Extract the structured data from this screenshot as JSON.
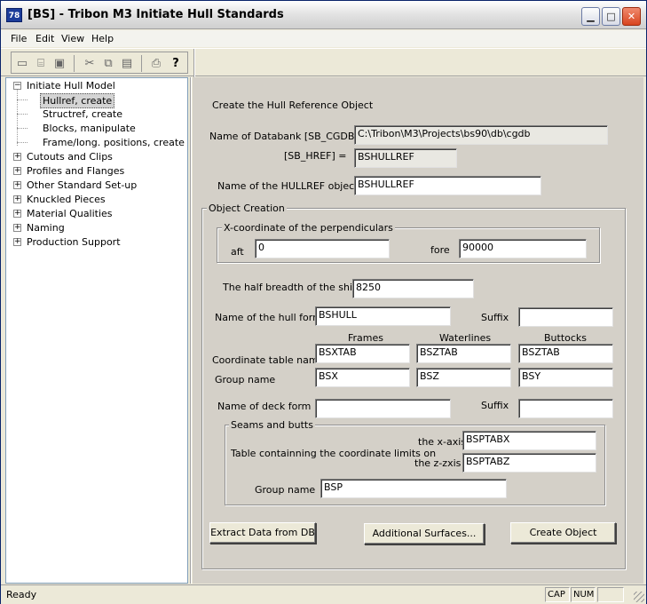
{
  "window": {
    "title": "[BS] - Tribon M3 Initiate Hull Standards",
    "icon_text": "78"
  },
  "menu": [
    "File",
    "Edit",
    "View",
    "Help"
  ],
  "toolbar": {
    "buttons": [
      "new-icon",
      "open-icon",
      "save-icon",
      "cut-icon",
      "copy-icon",
      "paste-icon",
      "print-icon",
      "help-icon"
    ]
  },
  "tree": {
    "root": "Initiate Hull Model",
    "children": [
      "Hullref, create",
      "Structref, create",
      "Blocks, manipulate",
      "Frame/long. positions, create"
    ],
    "selected": "Hullref, create",
    "siblings": [
      "Cutouts and Clips",
      "Profiles and Flanges",
      "Other Standard Set-up",
      "Knuckled Pieces",
      "Material Qualities",
      "Naming",
      "Production Support"
    ]
  },
  "form": {
    "heading": "Create the Hull Reference Object",
    "databank_label": "Name of Databank [SB_CGDB] =",
    "databank_value": "C:\\Tribon\\M3\\Projects\\bs90\\db\\cgdb",
    "href_label": "[SB_HREF] =",
    "href_value": "BSHULLREF",
    "hullref_label": "Name of the HULLREF object",
    "hullref_value": "BSHULLREF",
    "object_creation": "Object Creation",
    "xcoord_group": "X-coordinate of the perpendiculars",
    "aft_label": "aft",
    "aft_value": "0",
    "fore_label": "fore",
    "fore_value": "90000",
    "half_breadth_label": "The half breadth of the ship",
    "half_breadth_value": "8250",
    "hull_form_label": "Name of the hull form",
    "hull_form_value": "BSHULL",
    "suffix_label": "Suffix",
    "hull_suffix_value": "",
    "col_frames": "Frames",
    "col_waterlines": "Waterlines",
    "col_buttocks": "Buttocks",
    "coord_table_label": "Coordinate table name",
    "coord_frames": "BSXTAB",
    "coord_waterlines": "BSZTAB",
    "coord_buttocks": "BSZTAB",
    "group_name_label": "Group name",
    "group_frames": "BSX",
    "group_waterlines": "BSZ",
    "group_buttocks": "BSY",
    "deck_form_label": "Name of deck form",
    "deck_form_value": "",
    "deck_suffix_value": "",
    "seams_group": "Seams and butts",
    "limits_label": "Table containning the coordinate limits on",
    "xaxis_label": "the x-axis",
    "xaxis_value": "BSPTABX",
    "zaxis_label": "the z-zxis",
    "zaxis_value": "BSPTABZ",
    "seams_group_name_label": "Group name",
    "seams_group_name_value": "BSP",
    "btn_extract": "Extract Data from DB",
    "btn_additional": "Additional Surfaces...",
    "btn_create": "Create Object"
  },
  "status": {
    "text": "Ready",
    "cap": "CAP",
    "num": "NUM"
  }
}
